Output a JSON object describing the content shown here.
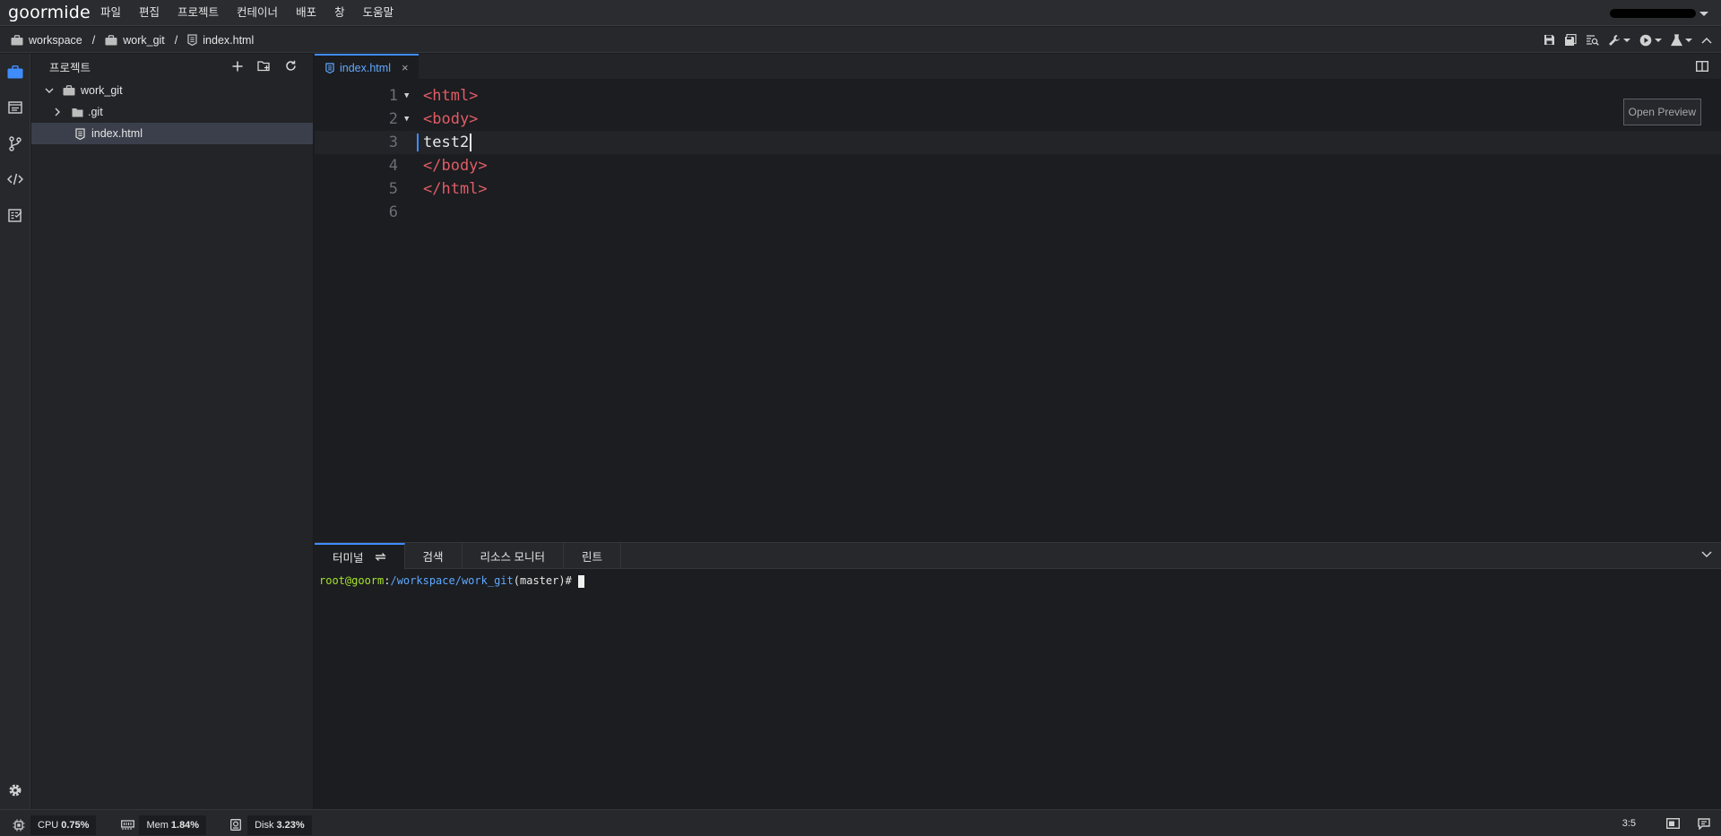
{
  "app": {
    "logo": "goormide"
  },
  "menubar": {
    "items": [
      "파일",
      "편집",
      "프로젝트",
      "컨테이너",
      "배포",
      "창",
      "도움말"
    ]
  },
  "breadcrumb": {
    "items": [
      "workspace",
      "work_git",
      "index.html"
    ],
    "separator": "/"
  },
  "toolbar": {
    "icons": [
      "save-icon",
      "save-all-icon",
      "find-icon",
      "build-icon",
      "run-icon",
      "test-icon",
      "collapse-up-icon"
    ]
  },
  "activitybar": {
    "icons": [
      "project-icon",
      "window-icon",
      "git-icon",
      "code-icon",
      "checklist-icon",
      "settings-icon"
    ]
  },
  "sidebar": {
    "title": "프로젝트",
    "tree": [
      {
        "label": "work_git",
        "type": "folder",
        "expanded": true
      },
      {
        "label": ".git",
        "type": "folder",
        "expanded": false
      },
      {
        "label": "index.html",
        "type": "file",
        "selected": true
      }
    ]
  },
  "editor": {
    "tab": {
      "label": "index.html",
      "close": "×"
    },
    "open_preview": "Open Preview",
    "lines": [
      {
        "num": "1",
        "text": "<html>"
      },
      {
        "num": "2",
        "text": "<body>"
      },
      {
        "num": "3",
        "text": "test2"
      },
      {
        "num": "4",
        "text": "</body>"
      },
      {
        "num": "5",
        "text": "</html>"
      },
      {
        "num": "6",
        "text": ""
      }
    ],
    "colors": {
      "tag": "#e05c66",
      "accent": "#3f8cff"
    }
  },
  "panel": {
    "tabs": [
      "터미널",
      "검색",
      "리소스 모니터",
      "린트"
    ],
    "terminal": {
      "user": "root@goorm",
      "colon": ":",
      "path": "/workspace/work_git",
      "branch": "(master)",
      "prompt": "#"
    }
  },
  "statusbar": {
    "cpu": {
      "label": "CPU",
      "value": "0.75%"
    },
    "mem": {
      "label": "Mem",
      "value": "1.84%"
    },
    "disk": {
      "label": "Disk",
      "value": "3.23%"
    },
    "cursor_pos": "3:5"
  }
}
